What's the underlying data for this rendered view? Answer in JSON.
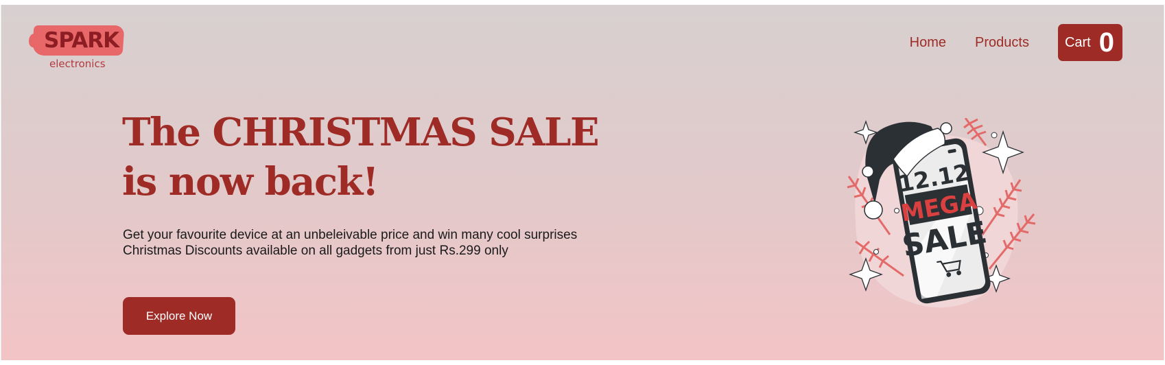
{
  "logo": {
    "name": "SPARK",
    "sub": "electronics"
  },
  "nav": {
    "home": "Home",
    "products": "Products",
    "cart_label": "Cart",
    "cart_count": "0"
  },
  "hero": {
    "line1": "The CHRISTMAS SALE",
    "line2": "is now back!",
    "desc1": "Get your favourite device at an unbeleivable price and win many cool surprises",
    "desc2": "Christmas Discounts available on all gadgets from just Rs.299 only",
    "cta": "Explore Now"
  },
  "illustration": {
    "screen_line1": "12.12",
    "screen_line2": "MEGA",
    "screen_line3": "SALE",
    "icon": "shopping-cart-icon"
  },
  "colors": {
    "accent": "#9e2b25",
    "brush": "#e8686a",
    "leaf": "#e46a6a"
  }
}
